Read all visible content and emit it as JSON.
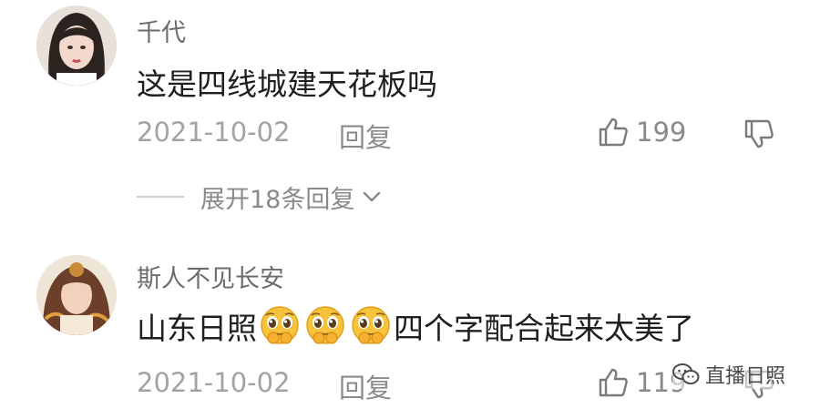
{
  "comments": [
    {
      "username": "千代",
      "text": "这是四线城建天花板吗",
      "date": "2021-10-02",
      "reply_label": "回复",
      "likes": "199"
    },
    {
      "username": "斯人不见长安",
      "text_before": "山东日照",
      "text_after": "四个字配合起来太美了",
      "emoji_count": 3,
      "date": "2021-10-02",
      "reply_label": "回复",
      "likes": "119"
    }
  ],
  "expand_replies": {
    "label": "展开18条回复"
  },
  "watermark": {
    "label": "直播日照"
  },
  "icons": {
    "like": "thumb-up-icon",
    "dislike": "thumb-down-icon",
    "expand": "chevron-down-icon",
    "emoji": "pleading-face-emoji-icon",
    "watermark": "wechat-icon"
  },
  "colors": {
    "username": "#6c6c6c",
    "text": "#1f1f1f",
    "meta": "#a3a3a3"
  }
}
